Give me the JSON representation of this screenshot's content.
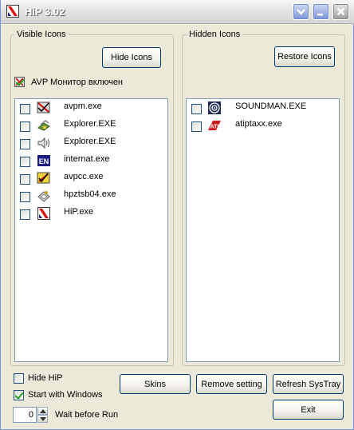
{
  "window": {
    "title": "HiP 3.02"
  },
  "visible": {
    "group_label": "Visible Icons",
    "hide_button": "Hide Icons",
    "avp_label": "AVP Монитор включен",
    "items": [
      {
        "label": "avpm.exe",
        "icon": "avp-monitor-icon"
      },
      {
        "label": "Explorer.EXE",
        "icon": "explorer-icon"
      },
      {
        "label": "Explorer.EXE",
        "icon": "volume-speaker-icon"
      },
      {
        "label": "internat.exe",
        "icon": "language-en-icon"
      },
      {
        "label": "avpcc.exe",
        "icon": "avp-control-center-icon"
      },
      {
        "label": "hpztsb04.exe",
        "icon": "hp-printer-icon"
      },
      {
        "label": "HiP.exe",
        "icon": "hip-app-icon"
      }
    ]
  },
  "hidden": {
    "group_label": "Hidden Icons",
    "restore_button": "Restore Icons",
    "items": [
      {
        "label": "SOUNDMAN.EXE",
        "icon": "soundman-icon"
      },
      {
        "label": "atiptaxx.exe",
        "icon": "ati-icon"
      }
    ]
  },
  "options": {
    "hide_hip": "Hide HiP",
    "start_with_windows": "Start with Windows",
    "wait_value": "0",
    "wait_label": "Wait before Run"
  },
  "buttons": {
    "skins": "Skins",
    "remove_setting": "Remove setting",
    "refresh_systray": "Refresh SysTray",
    "exit": "Exit"
  }
}
